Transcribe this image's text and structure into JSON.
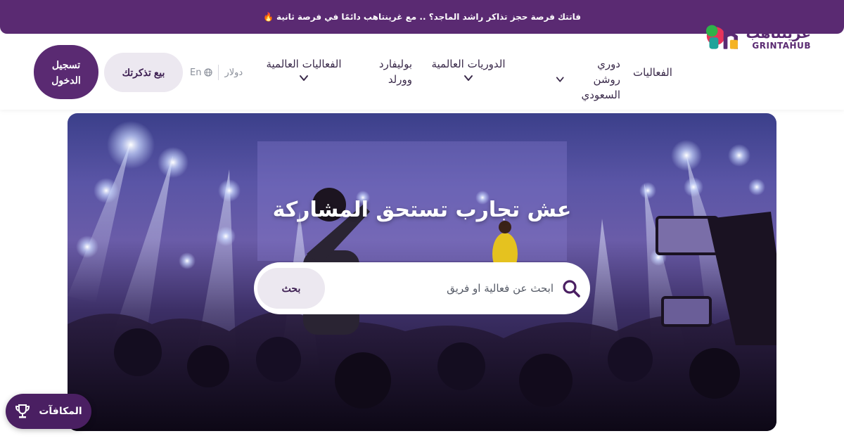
{
  "announcement": {
    "text": "فاتتك فرصة حجز تذاكر راشد الماجد؟ .. مع غرينتاهب دائمًا في فرصة ثانية",
    "emoji": "🔥"
  },
  "brand": {
    "name_ar": "غرينتاهب",
    "name_en": "GRINTAHUB",
    "color": "#5a2a72"
  },
  "nav": {
    "events": "الفعاليات",
    "roshn_league": "دوري روشن السعودي",
    "global_leagues": "الدوريات العالمية",
    "boulevard": "بوليفارد وورلد",
    "global_events": "الفعاليات العالمية"
  },
  "locale": {
    "currency": "دولار",
    "language": "En"
  },
  "actions": {
    "sell_tickets": "بيع تذكرتك",
    "login": "تسجيل الدخول"
  },
  "hero": {
    "title": "عش تجارب تستحق المشاركة",
    "search_placeholder": "ابحث عن فعالية او فريق",
    "search_button": "بحث"
  },
  "rewards": {
    "label": "المكافآت"
  },
  "icons": {
    "search": "search-icon",
    "globe": "globe-icon",
    "chevron": "chevron-down-icon",
    "trophy": "trophy-icon"
  }
}
